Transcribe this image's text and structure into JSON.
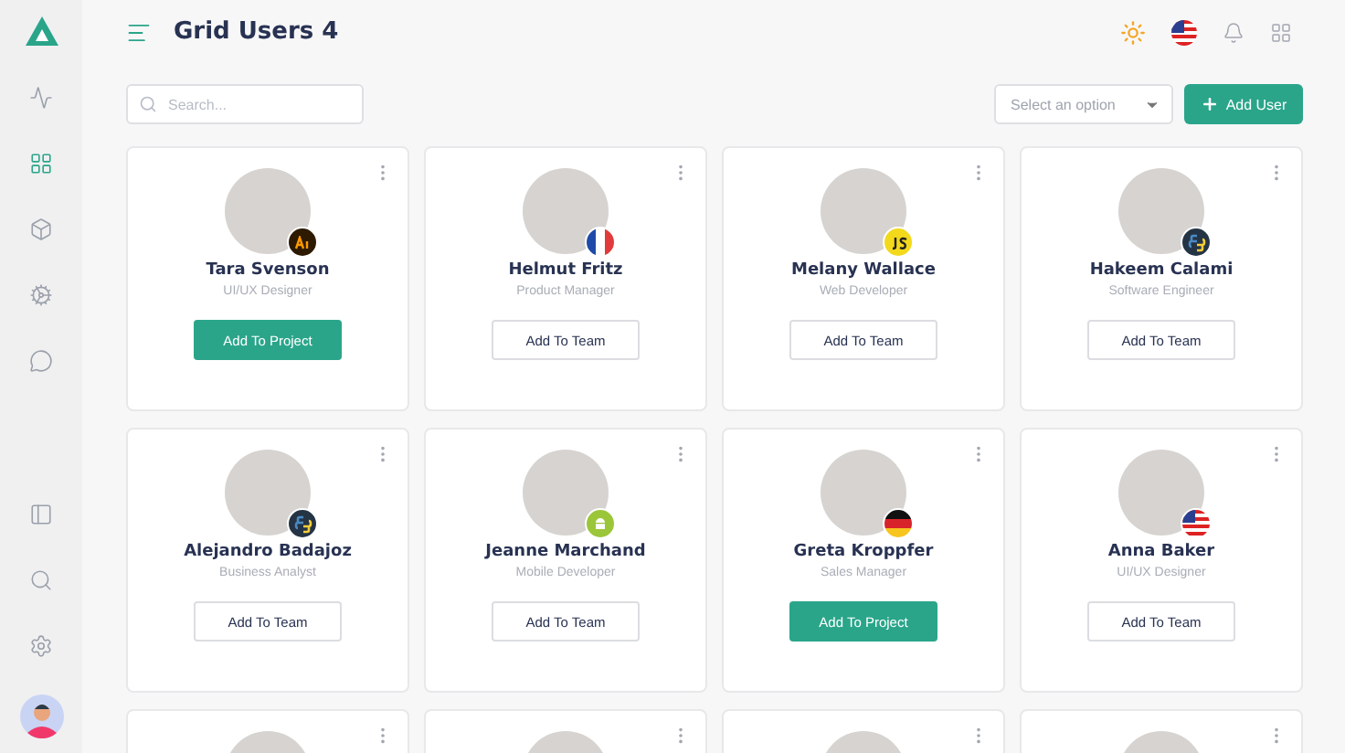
{
  "sidebar": {
    "items": [
      {
        "selected": false
      },
      {
        "selected": true
      },
      {
        "selected": false
      },
      {
        "selected": false
      },
      {
        "selected": false
      }
    ]
  },
  "header": {
    "title": "Grid Users 4"
  },
  "toolbar": {
    "search": {
      "placeholder": "Search..."
    },
    "select": {
      "placeholder": "Select an option"
    },
    "add_button": "Add User"
  },
  "cards": [
    {
      "menu": true,
      "badge": {
        "kind": "ai"
      },
      "name": "Tara Svenson",
      "role": "UI/UX Designer",
      "button": {
        "label": "Add To Project",
        "primary": true
      }
    },
    {
      "menu": true,
      "badge": {
        "kind": "flag-fr"
      },
      "name": "Helmut Fritz",
      "role": "Product Manager",
      "button": {
        "label": "Add To Team",
        "primary": false
      }
    },
    {
      "menu": true,
      "badge": {
        "kind": "js"
      },
      "name": "Melany Wallace",
      "role": "Web Developer",
      "button": {
        "label": "Add To Team",
        "primary": false
      }
    },
    {
      "menu": true,
      "badge": {
        "kind": "python"
      },
      "name": "Hakeem Calami",
      "role": "Software Engineer",
      "button": {
        "label": "Add To Team",
        "primary": false
      }
    },
    {
      "menu": true,
      "badge": {
        "kind": "python"
      },
      "name": "Alejandro Badajoz",
      "role": "Business Analyst",
      "button": {
        "label": "Add To Team",
        "primary": false
      }
    },
    {
      "menu": true,
      "badge": {
        "kind": "android"
      },
      "name": "Jeanne Marchand",
      "role": "Mobile Developer",
      "button": {
        "label": "Add To Team",
        "primary": false
      }
    },
    {
      "menu": true,
      "badge": {
        "kind": "flag-de"
      },
      "name": "Greta Kroppfer",
      "role": "Sales Manager",
      "button": {
        "label": "Add To Project",
        "primary": true
      }
    },
    {
      "menu": true,
      "badge": {
        "kind": "flag-us"
      },
      "name": "Anna Baker",
      "role": "UI/UX Designer",
      "button": {
        "label": "Add To Team",
        "primary": false
      }
    },
    {
      "menu": true
    },
    {
      "menu": true
    },
    {
      "menu": true
    },
    {
      "menu": true
    }
  ]
}
